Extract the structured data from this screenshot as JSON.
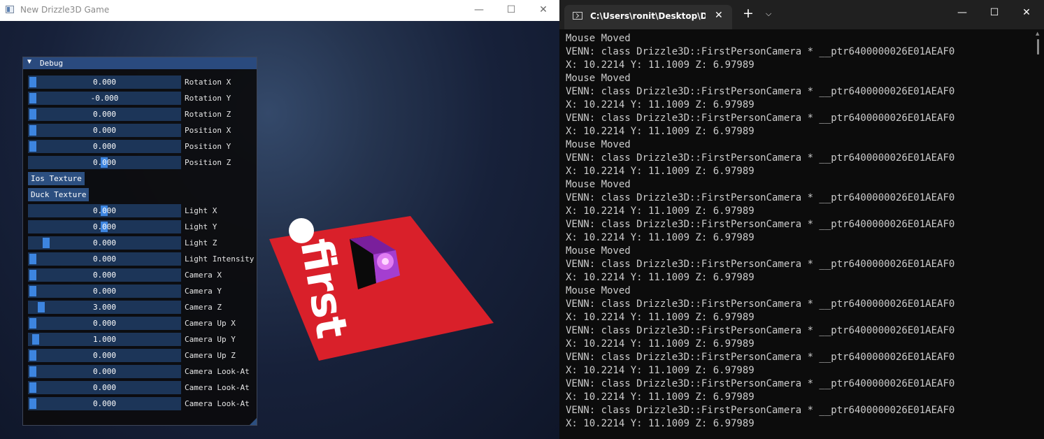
{
  "game_window": {
    "title": "New Drizzle3D Game",
    "minimize": "—",
    "maximize": "☐",
    "close": "✕"
  },
  "debug_panel": {
    "header": "Debug",
    "collapse_arrow": "▼",
    "rows": [
      {
        "value": "0.000",
        "label": "Rotation X"
      },
      {
        "value": "-0.000",
        "label": "Rotation Y"
      },
      {
        "value": "0.000",
        "label": "Rotation Z"
      },
      {
        "value": "0.000",
        "label": "Position X"
      },
      {
        "value": "0.000",
        "label": "Position Y"
      },
      {
        "value": "0.000",
        "label": "Position Z"
      },
      {
        "value": "0.000",
        "label": "Light X"
      },
      {
        "value": "0.000",
        "label": "Light Y"
      },
      {
        "value": "0.000",
        "label": "Light Z"
      },
      {
        "value": "0.000",
        "label": "Light Intensity"
      },
      {
        "value": "0.000",
        "label": "Camera X"
      },
      {
        "value": "0.000",
        "label": "Camera Y"
      },
      {
        "value": "3.000",
        "label": "Camera Z"
      },
      {
        "value": "0.000",
        "label": "Camera Up X"
      },
      {
        "value": "1.000",
        "label": "Camera Up Y"
      },
      {
        "value": "0.000",
        "label": "Camera Up Z"
      },
      {
        "value": "0.000",
        "label": "Camera Look-At"
      },
      {
        "value": "0.000",
        "label": "Camera Look-At"
      },
      {
        "value": "0.000",
        "label": "Camera Look-At"
      }
    ],
    "buttons": {
      "ios_texture": "Ios Texture",
      "duck_texture": "Duck Texture"
    }
  },
  "scene": {
    "plane_color": "#d9202a",
    "plane_text": "first",
    "cube_color": "#b03ad8"
  },
  "terminal": {
    "tab_title": "C:\\Users\\ronit\\Desktop\\Drizzle",
    "tab_close": "✕",
    "new_tab": "+",
    "dropdown": "⌵",
    "minimize": "—",
    "maximize": "☐",
    "close": "✕",
    "lines": [
      "Mouse Moved",
      "VENN: class Drizzle3D::FirstPersonCamera * __ptr6400000026E01AEAF0",
      "X: 10.2214 Y: 11.1009 Z: 6.97989",
      "Mouse Moved",
      "VENN: class Drizzle3D::FirstPersonCamera * __ptr6400000026E01AEAF0",
      "X: 10.2214 Y: 11.1009 Z: 6.97989",
      "VENN: class Drizzle3D::FirstPersonCamera * __ptr6400000026E01AEAF0",
      "X: 10.2214 Y: 11.1009 Z: 6.97989",
      "Mouse Moved",
      "VENN: class Drizzle3D::FirstPersonCamera * __ptr6400000026E01AEAF0",
      "X: 10.2214 Y: 11.1009 Z: 6.97989",
      "Mouse Moved",
      "VENN: class Drizzle3D::FirstPersonCamera * __ptr6400000026E01AEAF0",
      "X: 10.2214 Y: 11.1009 Z: 6.97989",
      "VENN: class Drizzle3D::FirstPersonCamera * __ptr6400000026E01AEAF0",
      "X: 10.2214 Y: 11.1009 Z: 6.97989",
      "Mouse Moved",
      "VENN: class Drizzle3D::FirstPersonCamera * __ptr6400000026E01AEAF0",
      "X: 10.2214 Y: 11.1009 Z: 6.97989",
      "Mouse Moved",
      "VENN: class Drizzle3D::FirstPersonCamera * __ptr6400000026E01AEAF0",
      "X: 10.2214 Y: 11.1009 Z: 6.97989",
      "VENN: class Drizzle3D::FirstPersonCamera * __ptr6400000026E01AEAF0",
      "X: 10.2214 Y: 11.1009 Z: 6.97989",
      "VENN: class Drizzle3D::FirstPersonCamera * __ptr6400000026E01AEAF0",
      "X: 10.2214 Y: 11.1009 Z: 6.97989",
      "VENN: class Drizzle3D::FirstPersonCamera * __ptr6400000026E01AEAF0",
      "X: 10.2214 Y: 11.1009 Z: 6.97989",
      "VENN: class Drizzle3D::FirstPersonCamera * __ptr6400000026E01AEAF0",
      "X: 10.2214 Y: 11.1009 Z: 6.97989"
    ]
  }
}
